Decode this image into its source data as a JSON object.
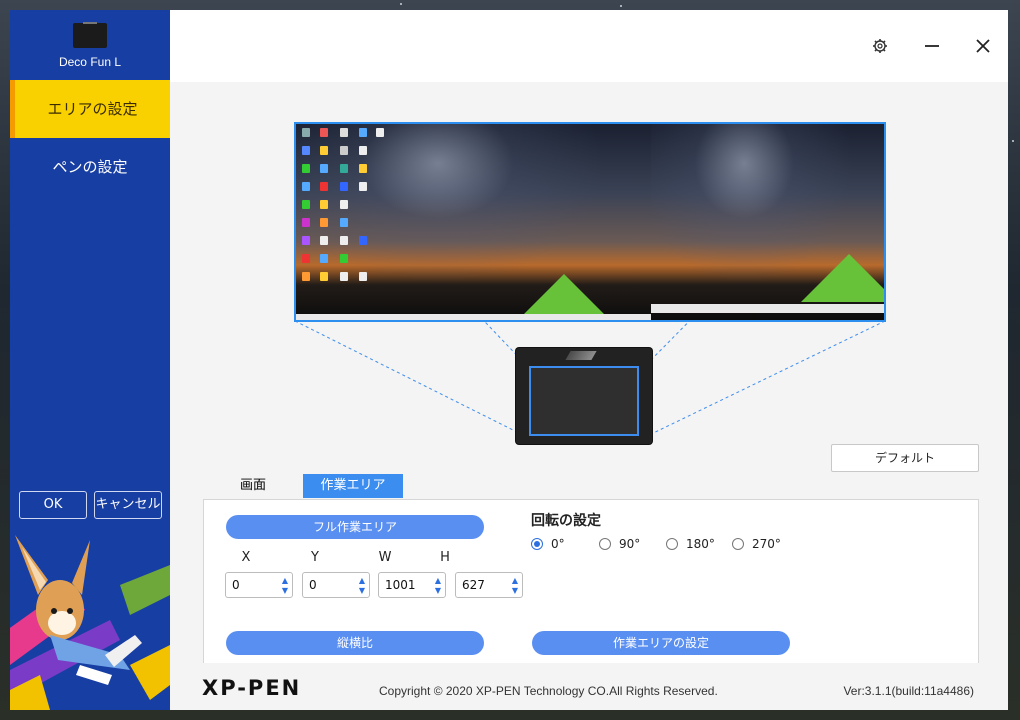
{
  "device": {
    "name": "Deco Fun L"
  },
  "sidebar": {
    "items": [
      {
        "label": "エリアの設定",
        "active": true
      },
      {
        "label": "ペンの設定",
        "active": false
      }
    ],
    "ok_label": "OK",
    "cancel_label": "キャンセル"
  },
  "header": {
    "icons": [
      "gear-icon",
      "minimize-icon",
      "close-icon"
    ]
  },
  "area": {
    "default_label": "デフォルト",
    "tabs": [
      {
        "label": "画面",
        "active": false
      },
      {
        "label": "作業エリア",
        "active": true
      }
    ],
    "full_area_label": "フル作業エリア",
    "rotation": {
      "title": "回転の設定",
      "options": [
        "0°",
        "90°",
        "180°",
        "270°"
      ],
      "selected": "0°"
    },
    "fields": [
      {
        "label": "X",
        "value": "0"
      },
      {
        "label": "Y",
        "value": "0"
      },
      {
        "label": "W",
        "value": "1001"
      },
      {
        "label": "H",
        "value": "627"
      }
    ],
    "aspect_label": "縦横比",
    "set_area_label": "作業エリアの設定"
  },
  "footer": {
    "logo": "XP-PEN",
    "copyright": "Copyright © 2020 XP-PEN Technology CO.All Rights Reserved.",
    "version": "Ver:3.1.1(build:11a4486)"
  },
  "colors": {
    "accent": "#3b8df0",
    "sidebar": "#173ea2",
    "active_nav": "#fad100"
  }
}
